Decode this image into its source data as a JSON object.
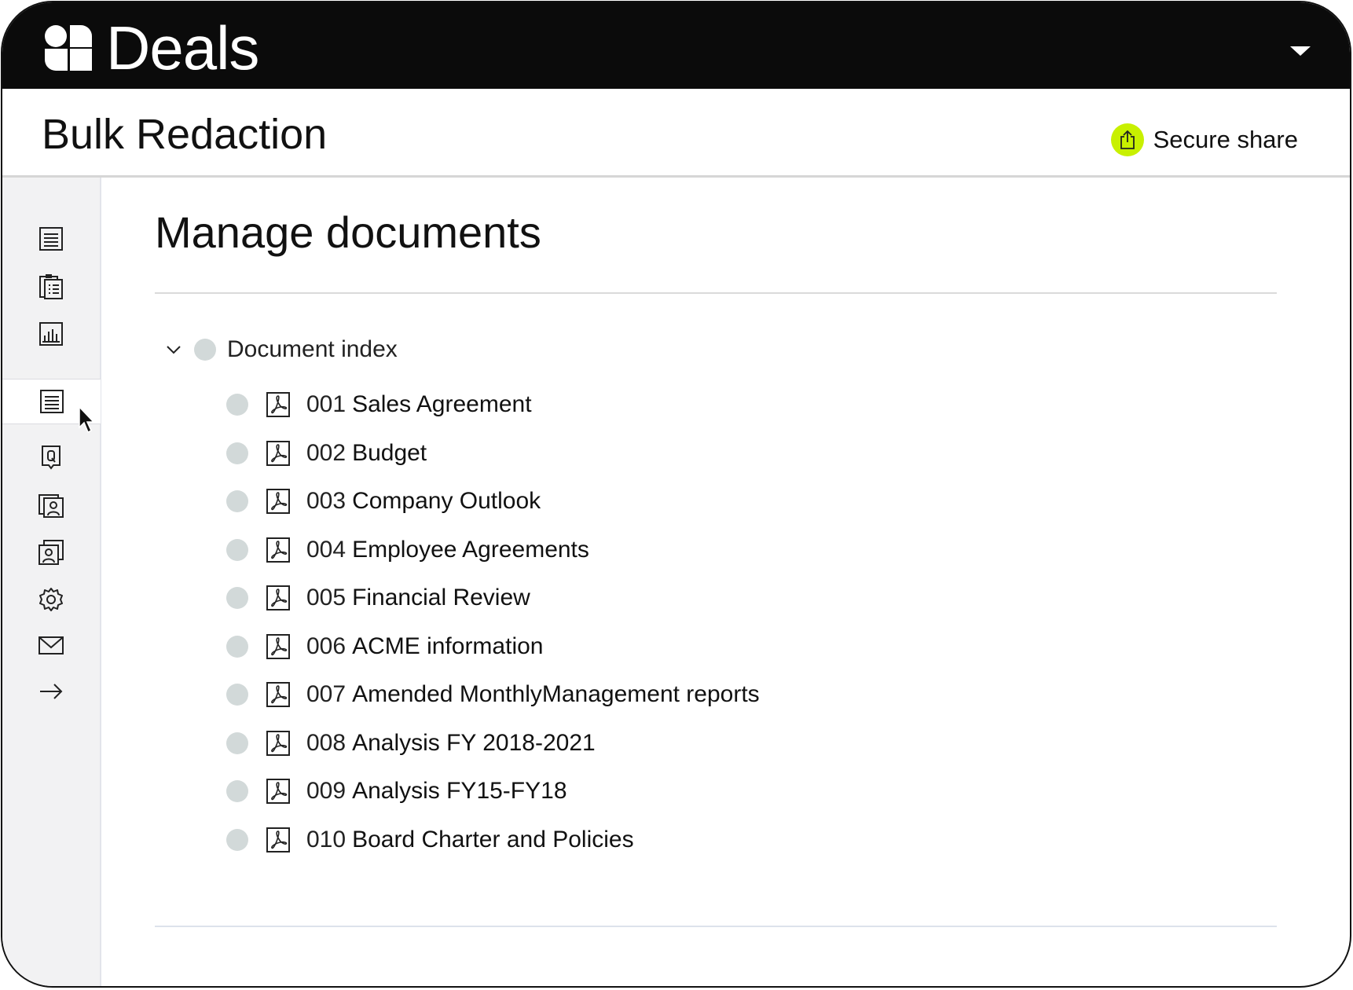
{
  "app": {
    "title": "Deals"
  },
  "header": {
    "title": "Bulk Redaction",
    "share_label": "Secure share"
  },
  "sidebar": {
    "items": [
      {
        "icon": "list-icon"
      },
      {
        "icon": "clipboard-icon"
      },
      {
        "icon": "bar-chart-icon"
      },
      {
        "icon": "document-list-icon",
        "active": true
      },
      {
        "icon": "q-and-a-icon"
      },
      {
        "icon": "user-folder-icon"
      },
      {
        "icon": "users-folder-icon"
      },
      {
        "icon": "gear-icon"
      },
      {
        "icon": "mail-icon"
      },
      {
        "icon": "arrow-right-icon"
      }
    ]
  },
  "main": {
    "title": "Manage documents",
    "index_label": "Document index",
    "documents": [
      {
        "num": "001",
        "name": "Sales Agreement"
      },
      {
        "num": "002",
        "name": "Budget"
      },
      {
        "num": "003",
        "name": "Company Outlook"
      },
      {
        "num": "004",
        "name": "Employee Agreements"
      },
      {
        "num": "005",
        "name": "Financial Review"
      },
      {
        "num": "006",
        "name": "ACME information"
      },
      {
        "num": "007",
        "name": "Amended MonthlyManagement reports"
      },
      {
        "num": "008",
        "name": "Analysis FY 2018-2021"
      },
      {
        "num": "009",
        "name": "Analysis FY15-FY18"
      },
      {
        "num": "010",
        "name": "Board Charter and Policies"
      }
    ]
  },
  "colors": {
    "accent": "#c8f000",
    "topbar": "#0b0b0b",
    "status_dot": "#d2d9d9"
  }
}
